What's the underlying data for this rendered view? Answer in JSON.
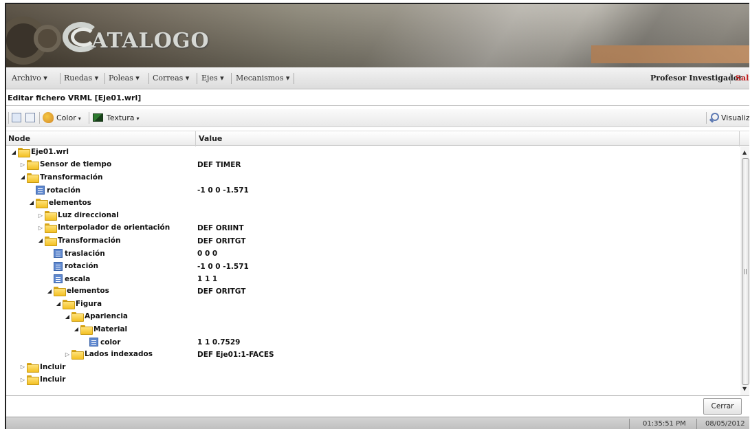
{
  "app": {
    "logo_text": "ATALOGO"
  },
  "menu": {
    "items": [
      {
        "label": "Archivo ▾"
      },
      {
        "label": "Ruedas ▾"
      },
      {
        "label": "Poleas ▾"
      },
      {
        "label": "Correas ▾"
      },
      {
        "label": "Ejes ▾"
      },
      {
        "label": "Mecanismos ▾"
      }
    ],
    "user": "Profesor Investigador",
    "exit": "Salir"
  },
  "panel": {
    "title": "Editar fichero VRML [Eje01.wrl]"
  },
  "toolbar": {
    "color_label": "Color",
    "texture_label": "Textura",
    "visualize_label": "Visualizar"
  },
  "columns": {
    "node": "Node",
    "value": "Value"
  },
  "tree": [
    {
      "label": "Eje01.wrl",
      "value": "",
      "icon": "folder-icon",
      "state": "expanded"
    },
    {
      "label": "Sensor de tiempo",
      "value": "DEF TIMER",
      "icon": "folder-icon",
      "state": "collapsed"
    },
    {
      "label": "Transformación",
      "value": "",
      "icon": "folder-icon",
      "state": "expanded"
    },
    {
      "label": "rotación",
      "value": "-1 0 0 -1.571",
      "icon": "field-icon",
      "state": "leaf"
    },
    {
      "label": "elementos",
      "value": "",
      "icon": "folder-icon",
      "state": "expanded"
    },
    {
      "label": "Luz direccional",
      "value": "",
      "icon": "folder-icon",
      "state": "collapsed"
    },
    {
      "label": "Interpolador de orientación",
      "value": "DEF ORIINT",
      "icon": "folder-icon",
      "state": "collapsed"
    },
    {
      "label": "Transformación",
      "value": "DEF ORITGT",
      "icon": "folder-icon",
      "state": "expanded"
    },
    {
      "label": "traslación",
      "value": "0 0 0",
      "icon": "field-icon",
      "state": "leaf"
    },
    {
      "label": "rotación",
      "value": "-1 0 0 -1.571",
      "icon": "field-icon",
      "state": "leaf"
    },
    {
      "label": "escala",
      "value": "1 1 1",
      "icon": "field-icon",
      "state": "leaf"
    },
    {
      "label": "elementos",
      "value": "DEF ORITGT",
      "icon": "folder-icon",
      "state": "expanded"
    },
    {
      "label": "Figura",
      "value": "",
      "icon": "folder-icon",
      "state": "expanded"
    },
    {
      "label": "Apariencia",
      "value": "",
      "icon": "folder-icon",
      "state": "expanded"
    },
    {
      "label": "Material",
      "value": "",
      "icon": "folder-icon",
      "state": "expanded"
    },
    {
      "label": "color",
      "value": "1 1 0.7529",
      "icon": "field-icon",
      "state": "leaf"
    },
    {
      "label": "Lados indexados",
      "value": "DEF Eje01:1-FACES",
      "icon": "folder-icon",
      "state": "collapsed"
    },
    {
      "label": "Incluir",
      "value": "",
      "icon": "folder-icon",
      "state": "collapsed"
    },
    {
      "label": "Incluir",
      "value": "",
      "icon": "folder-icon",
      "state": "collapsed"
    }
  ],
  "footer": {
    "close_label": "Cerrar"
  },
  "status": {
    "time": "01:35:51 PM",
    "date": "08/05/2012"
  }
}
